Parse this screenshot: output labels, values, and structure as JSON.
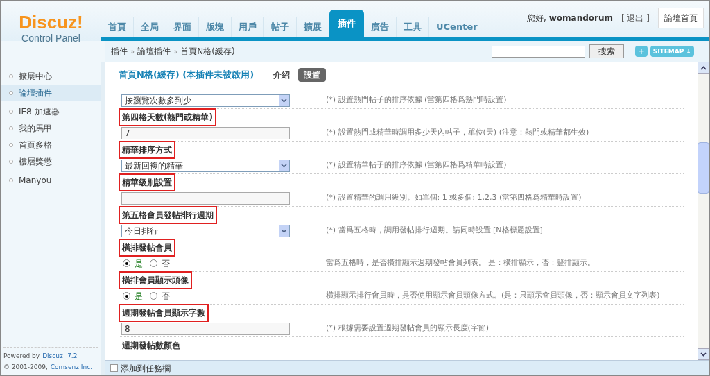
{
  "logo": {
    "brand": "Discuz!",
    "subtitle": "Control Panel"
  },
  "nav_tabs": [
    {
      "label": "首頁",
      "selected": false
    },
    {
      "label": "全局",
      "selected": false
    },
    {
      "label": "界面",
      "selected": false
    },
    {
      "label": "版塊",
      "selected": false
    },
    {
      "label": "用戶",
      "selected": false
    },
    {
      "label": "帖子",
      "selected": false
    },
    {
      "label": "擴展",
      "selected": false
    },
    {
      "label": "插件",
      "selected": true
    },
    {
      "label": "廣告",
      "selected": false
    },
    {
      "label": "工具",
      "selected": false
    },
    {
      "label": "UCenter",
      "selected": false
    }
  ],
  "user": {
    "greeting": "您好,",
    "name": "womandorum",
    "logout": "[ 退出 ]",
    "home_button": "論壇首頁"
  },
  "breadcrumb": [
    "插件",
    "論壇插件",
    "首頁N格(緩存)"
  ],
  "breadcrumb_separator": "»",
  "search": {
    "button": "搜索"
  },
  "plus_button": "+",
  "sitemap_button": "SITEMAP ↓",
  "sidebar": {
    "items": [
      {
        "label": "擴展中心",
        "selected": false
      },
      {
        "label": "論壇插件",
        "selected": true
      },
      {
        "label": "IE8 加速器",
        "selected": false
      },
      {
        "label": "我的馬甲",
        "selected": false
      },
      {
        "label": "首頁多格",
        "selected": false
      },
      {
        "label": "樓層獎懲",
        "selected": false
      },
      {
        "label": "Manyou",
        "selected": false
      }
    ],
    "powered": "Powered by",
    "product": "Discuz! 7.2",
    "copyright": "© 2001-2009,",
    "company": "Comsenz Inc."
  },
  "page_title": "首頁N格(緩存) (本插件未被啟用)",
  "page_tabs": [
    {
      "label": "介紹",
      "selected": false
    },
    {
      "label": "設置",
      "selected": true
    }
  ],
  "settings": [
    {
      "kind": "select",
      "value": "按瀏覽次數多到少",
      "description": "(*) 設置熱門帖子的排序依據 (當第四格爲熱門時設置)"
    },
    {
      "kind": "label",
      "label": "第四格天數(熱門或精華)",
      "highlighted": true
    },
    {
      "kind": "text",
      "value": "7",
      "description": "(*) 設置熱門或精華時調用多少天內帖子，單位(天) (注意：熱門或精華都生效)"
    },
    {
      "kind": "label",
      "label": "精華排序方式",
      "highlighted": true
    },
    {
      "kind": "select",
      "value": "最新回複的精華",
      "description": "(*) 設置精華帖子的排序依據 (當第四格爲精華時設置)"
    },
    {
      "kind": "label",
      "label": "精華級別設置",
      "highlighted": true
    },
    {
      "kind": "text",
      "description": "(*) 設置精華的調用級別。如單個: 1 或多個: 1,2,3 (當第四格爲精華時設置)"
    },
    {
      "kind": "label",
      "label": "第五格會員發帖排行週期",
      "highlighted": true
    },
    {
      "kind": "select",
      "value": "今日排行",
      "description": "(*) 當爲五格時，調用發帖排行週期。請同時設置 [N格標題設置]"
    },
    {
      "kind": "label",
      "label": "橫排發帖會員",
      "highlighted": true
    },
    {
      "kind": "radio",
      "options": [
        {
          "label": "是",
          "selected": true
        },
        {
          "label": "否",
          "selected": false
        }
      ],
      "description": "當爲五格時，是否橫排顯示週期發帖會員列表。 是：橫排顯示，否：豎排顯示。"
    },
    {
      "kind": "label",
      "label": "橫排會員顯示頭像",
      "highlighted": true
    },
    {
      "kind": "radio",
      "options": [
        {
          "label": "是",
          "selected": true
        },
        {
          "label": "否",
          "selected": false
        }
      ],
      "description": "橫排顯示排行會員時，是否使用顯示會員頭像方式。(是：只顯示會員頭像，否：顯示會員文字列表)"
    },
    {
      "kind": "label",
      "label": "週期發帖會員顯示字數",
      "highlighted": true
    },
    {
      "kind": "text",
      "value": "8",
      "description": "(*) 根據需要設置週期發帖會員的顯示長度(字節)"
    },
    {
      "kind": "label",
      "label": "週期發帖數顏色",
      "highlighted": false
    }
  ],
  "taskbar_link": "添加到任務欄"
}
